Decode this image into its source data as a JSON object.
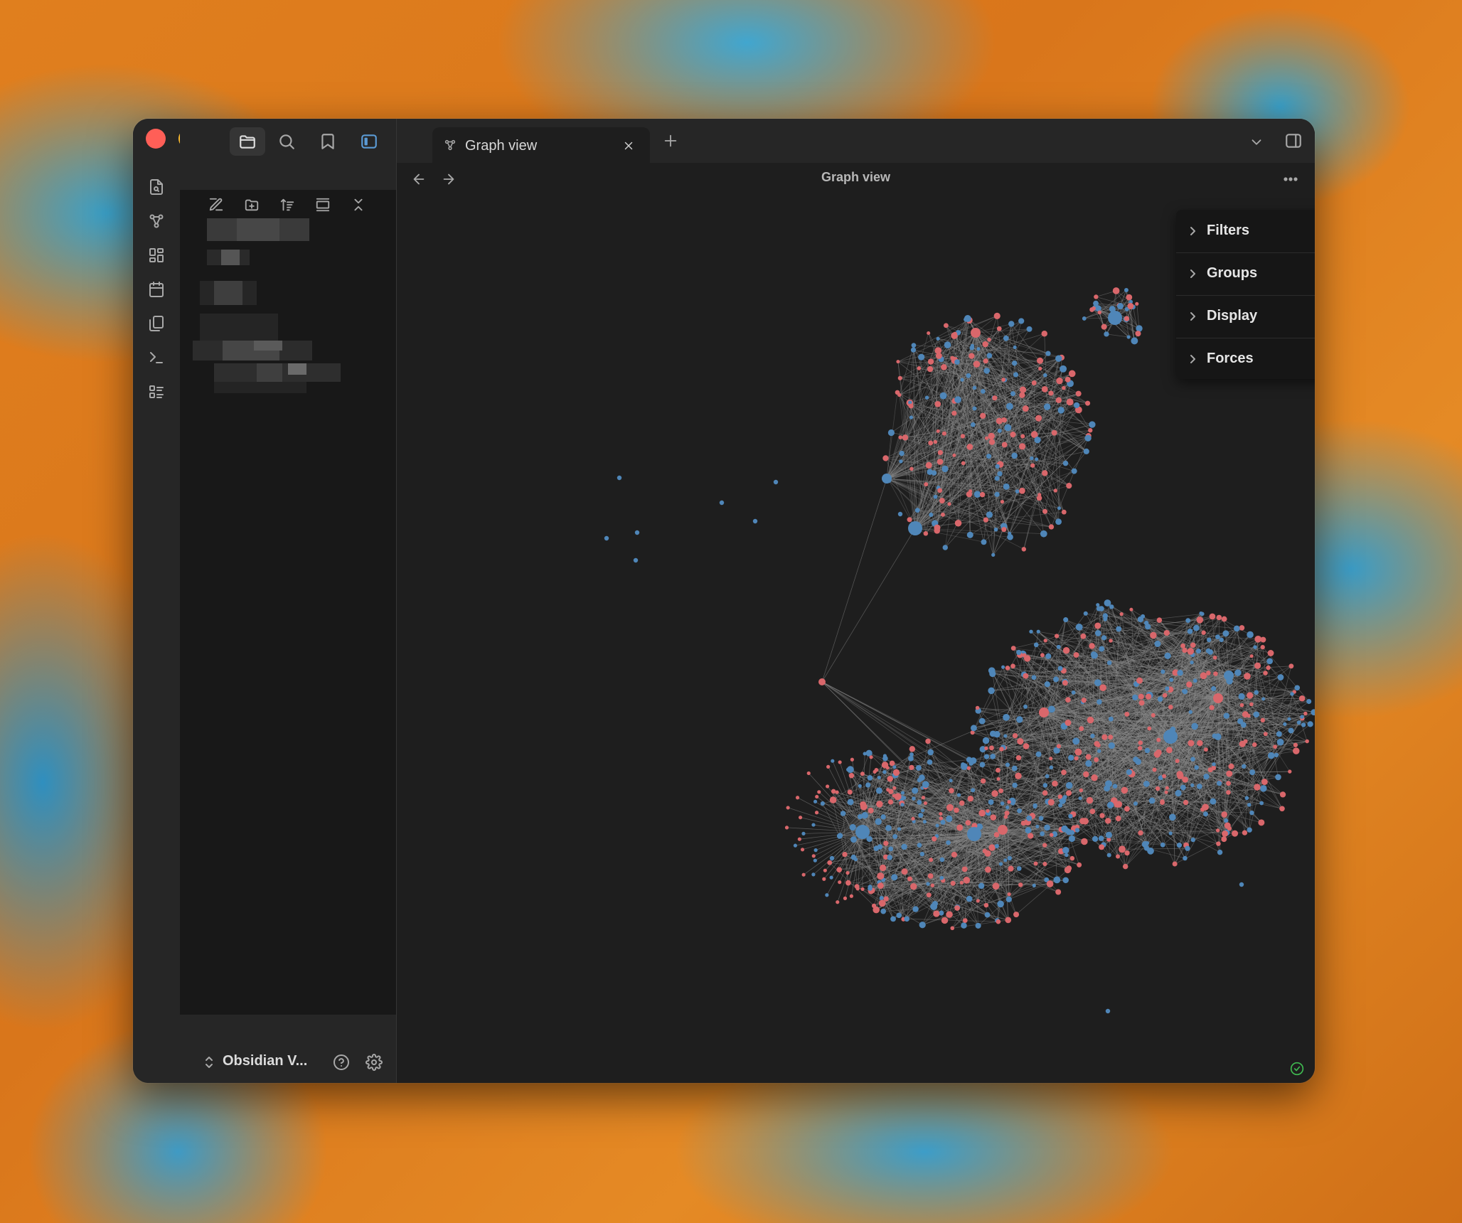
{
  "window": {
    "tab_title": "Graph view",
    "view_title": "Graph view"
  },
  "graph_panel": {
    "sections": [
      "Filters",
      "Groups",
      "Display",
      "Forces"
    ]
  },
  "vault": {
    "name": "Obsidian V..."
  },
  "colors": {
    "node_blue": "#4f86b8",
    "node_red": "#d9676b",
    "edge": "#8a8a8a",
    "background": "#1e1e1e",
    "sync_ok": "#3fb950"
  },
  "icons": {
    "ribbon": [
      "open-quick-switcher-icon",
      "graph-icon",
      "canvas-icon",
      "daily-note-icon",
      "templates-icon",
      "command-palette-icon",
      "slides-icon"
    ],
    "sidebar_toolbar": [
      "new-note-icon",
      "new-folder-icon",
      "sort-icon",
      "auto-reveal-icon",
      "collapse-all-icon"
    ]
  }
}
